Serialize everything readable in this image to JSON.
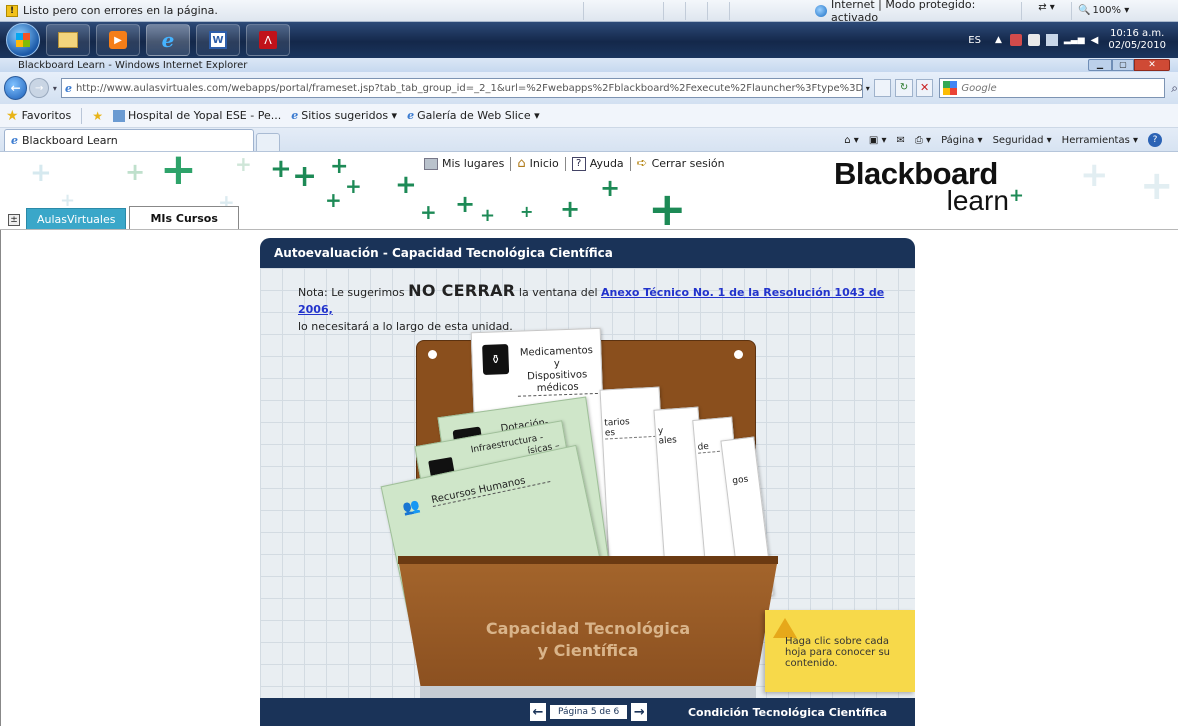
{
  "status_bar": {
    "message": "Listo pero con errores en la página.",
    "zone": "Internet | Modo protegido: activado",
    "zoom": "100%"
  },
  "taskbar": {
    "language": "ES",
    "time": "10:16 a.m.",
    "date": "02/05/2010"
  },
  "window": {
    "title": "Blackboard Learn - Windows Internet Explorer"
  },
  "address_bar": {
    "url": "http://www.aulasvirtuales.com/webapps/portal/frameset.jsp?tab_tab_group_id=_2_1&url=%2Fwebapps%2Fblackboard%2Fexecute%2Flauncher%3Ftype%3DCourse%26id%3D_1",
    "search_placeholder": "Google"
  },
  "favorites_bar": {
    "favorites_label": "Favoritos",
    "items": [
      "Hospital de Yopal ESE - Pe...",
      "Sitios sugeridos ▾",
      "Galería de Web Slice ▾"
    ]
  },
  "browser_tab": {
    "label": "Blackboard Learn"
  },
  "command_bar": {
    "page": "Página ▾",
    "security": "Seguridad ▾",
    "tools": "Herramientas ▾"
  },
  "bb_header": {
    "links": [
      "Mis lugares",
      "Inicio",
      "Ayuda",
      "Cerrar sesión"
    ],
    "logo_line1": "Blackboard",
    "logo_line2": "learn",
    "tabs": [
      "AulasVirtuales",
      "MIs Cursos"
    ]
  },
  "panel": {
    "title": "Autoevaluación - Capacidad Tecnológica Científica",
    "note_prefix": "Nota: Le sugerimos ",
    "note_bold": "no cerrar",
    "note_mid": " la ventana del ",
    "note_link": "Anexo Técnico No. 1 de la Resolución 1043 de 2006,",
    "note_suffix": "lo necesitará a lo largo de esta unidad.",
    "box_label_line1": "Capacidad Tecnológica",
    "box_label_line2": "y Científica",
    "tip": "Haga clic sobre cada hoja para conocer su contenido.",
    "pager": "Página 5 de 6",
    "footer_title": "Condición Tecnológica Científica",
    "sheets": {
      "s1_line1": "Medicamentos y",
      "s1_line2": "Dispositivos médicos",
      "s2": "tarios",
      "s2b": "es",
      "s3": "y",
      "s3b": "ales",
      "s4": "de",
      "s5": "gos",
      "g1_line1": "Dotación-",
      "g1_line2": "D",
      "g2_line1": "Infraestructura -",
      "g2_line2": "ísicas –",
      "g2_line3": "nto",
      "g3": "Recursos Humanos"
    }
  },
  "colors": {
    "panel_header": "#1a3358",
    "box_brown": "#9b5f2a",
    "sheet_green": "#cfe6c9",
    "tip_yellow": "#f7d94a",
    "link_blue": "#2233cc"
  }
}
